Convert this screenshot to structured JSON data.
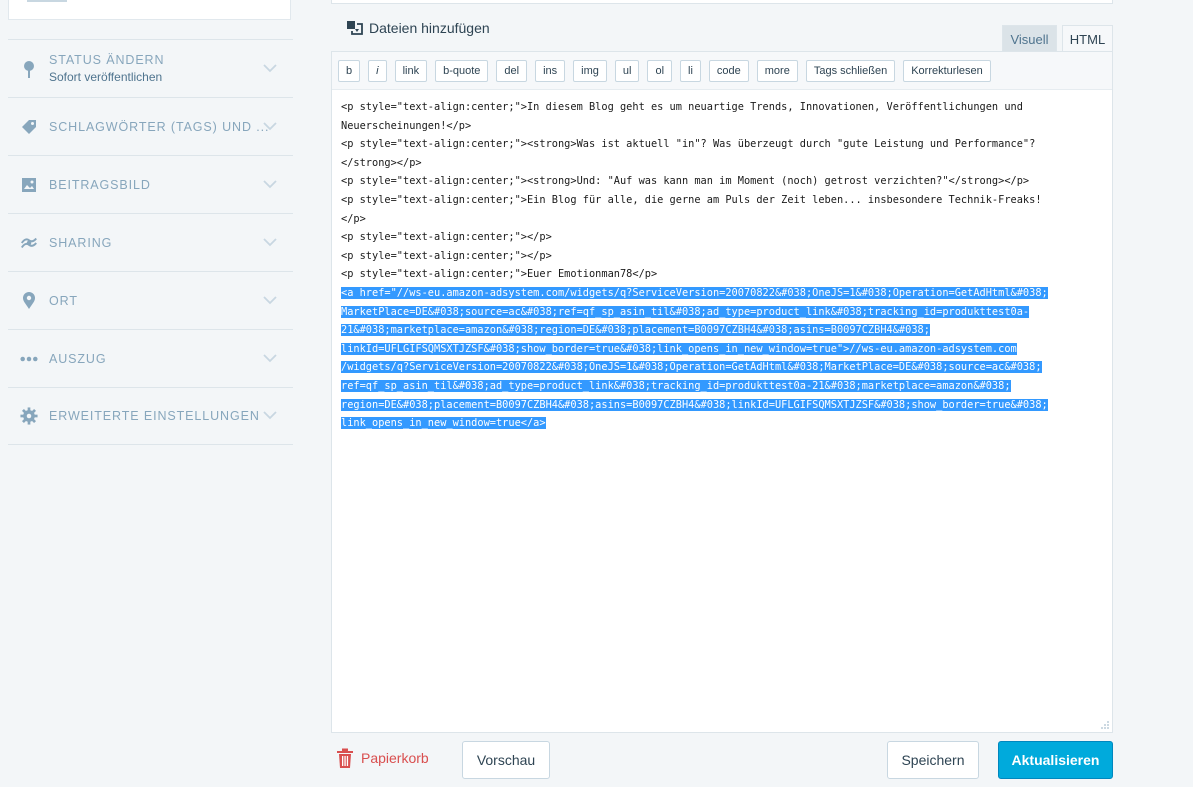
{
  "sidebar": {
    "items": [
      {
        "label": "Status ändern",
        "sub": "Sofort veröffentlichen",
        "icon": "pin-icon"
      },
      {
        "label": "Schlagwörter (Tags) und ...",
        "icon": "tag-icon"
      },
      {
        "label": "Beitragsbild",
        "icon": "image-icon"
      },
      {
        "label": "Sharing",
        "icon": "share-icon"
      },
      {
        "label": "Ort",
        "icon": "location-icon"
      },
      {
        "label": "Auszug",
        "icon": "ellipsis-icon"
      },
      {
        "label": "Erweiterte Einstellungen",
        "icon": "gear-icon"
      }
    ]
  },
  "editor": {
    "add_media_label": "Dateien hinzufügen",
    "tabs": {
      "visual": "Visuell",
      "html": "HTML",
      "active": "HTML"
    },
    "toolbar": [
      "b",
      "i",
      "link",
      "b-quote",
      "del",
      "ins",
      "img",
      "ul",
      "ol",
      "li",
      "code",
      "more",
      "Tags schließen",
      "Korrekturlesen"
    ],
    "content_lines": [
      "<p style=\"text-align:center;\">In diesem Blog geht es um neuartige Trends, Innovationen, Veröffentlichungen und",
      "Neuerscheinungen!</p>",
      "<p style=\"text-align:center;\"><strong>Was ist aktuell \"in\"? Was überzeugt durch \"gute Leistung und Performance\"?",
      "</strong></p>",
      "<p style=\"text-align:center;\"><strong>Und: \"Auf was kann man im Moment (noch) getrost verzichten?\"</strong></p>",
      "<p style=\"text-align:center;\">Ein Blog für alle, die gerne am Puls der Zeit leben... insbesondere Technik-Freaks!",
      "</p>",
      "<p style=\"text-align:center;\"></p>",
      "<p style=\"text-align:center;\"></p>",
      "<p style=\"text-align:center;\">Euer Emotionman78</p>"
    ],
    "selected_lines": [
      "<a href=\"//ws-eu.amazon-adsystem.com/widgets/q?ServiceVersion=20070822&#038;OneJS=1&#038;Operation=GetAdHtml&#038;",
      "MarketPlace=DE&#038;source=ac&#038;ref=qf_sp_asin_til&#038;ad_type=product_link&#038;tracking_id=produkttest0a-",
      "21&#038;marketplace=amazon&#038;region=DE&#038;placement=B0097CZBH4&#038;asins=B0097CZBH4&#038;",
      "linkId=UFLGIFSQMSXTJZSF&#038;show_border=true&#038;link_opens_in_new_window=true\">//ws-eu.amazon-adsystem.com",
      "/widgets/q?ServiceVersion=20070822&#038;OneJS=1&#038;Operation=GetAdHtml&#038;MarketPlace=DE&#038;source=ac&#038;",
      "ref=qf_sp_asin_til&#038;ad_type=product_link&#038;tracking_id=produkttest0a-21&#038;marketplace=amazon&#038;",
      "region=DE&#038;placement=B0097CZBH4&#038;asins=B0097CZBH4&#038;linkId=UFLGIFSQMSXTJZSF&#038;show_border=true&#038;",
      "link_opens_in_new_window=true</a>"
    ]
  },
  "actions": {
    "trash": "Papierkorb",
    "preview": "Vorschau",
    "save": "Speichern",
    "update": "Aktualisieren"
  },
  "colors": {
    "accent": "#00aadc",
    "selection": "#3399ff",
    "trash": "#d94f4f"
  }
}
